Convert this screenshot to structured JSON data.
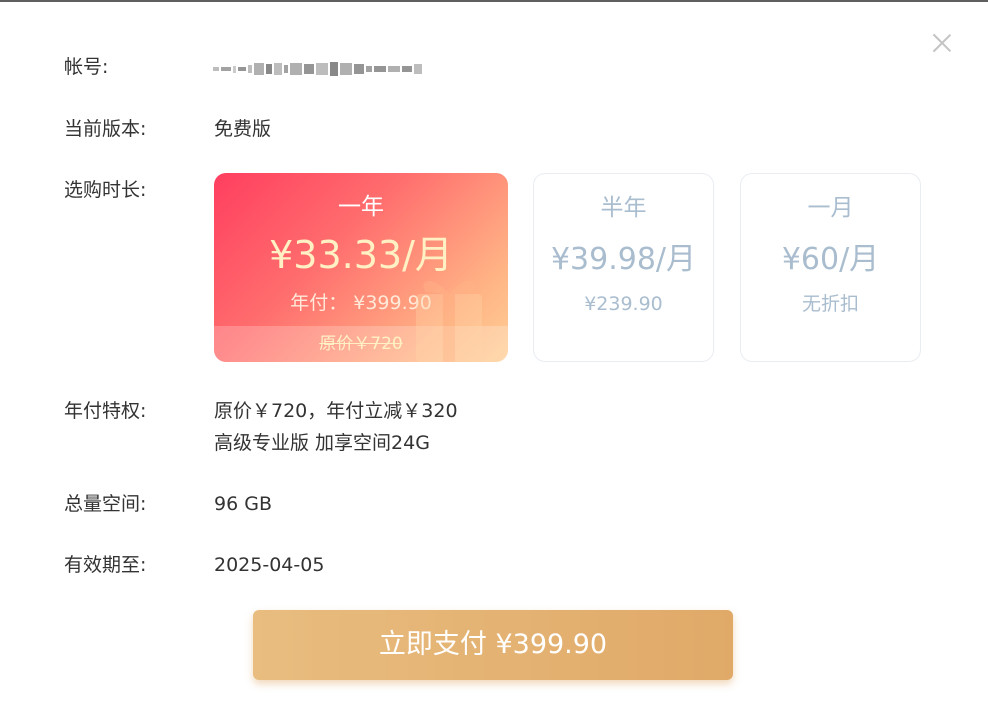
{
  "labels": {
    "account": "帐号:",
    "version": "当前版本:",
    "duration": "选购时长:",
    "privilege": "年付特权:",
    "space": "总量空间:",
    "expiry": "有效期至:"
  },
  "values": {
    "version": "免费版",
    "privilege_line1": "原价￥720，年付立减￥320",
    "privilege_line2": "高级专业版 加享空间24G",
    "space": "96 GB",
    "expiry": "2025-04-05"
  },
  "plans": [
    {
      "title": "一年",
      "price": "¥33.33/月",
      "sub": "年付：  ¥399.90",
      "original": "原价￥720",
      "selected": true
    },
    {
      "title": "半年",
      "price": "¥39.98/月",
      "sub": "¥239.90",
      "selected": false
    },
    {
      "title": "一月",
      "price": "¥60/月",
      "sub": "无折扣",
      "selected": false
    }
  ],
  "pay_button": "立即支付 ¥399.90",
  "icons": {
    "close": "close-icon",
    "gift": "gift-icon"
  },
  "colors": {
    "selected_gradient_start": "#ff3e5f",
    "selected_gradient_end": "#ffcf96",
    "pay_button": "#e3b173",
    "unselected_text": "#a9bdcf"
  }
}
